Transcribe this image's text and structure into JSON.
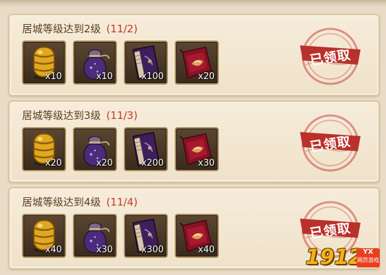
{
  "colors": {
    "progress": "#c0392b",
    "stamp": "#b8312a",
    "panel_bg": "#f3e8d4"
  },
  "tasks": [
    {
      "title": "居城等级达到2级",
      "progress": "(11/2)",
      "items": [
        {
          "icon": "gold-ingot-icon",
          "qty": "x10"
        },
        {
          "icon": "potion-bag-icon",
          "qty": "x10"
        },
        {
          "icon": "scroll-book-icon",
          "qty": "x100"
        },
        {
          "icon": "red-talisman-icon",
          "qty": "x20"
        }
      ],
      "stamp": "已领取"
    },
    {
      "title": "居城等级达到3级",
      "progress": "(11/3)",
      "items": [
        {
          "icon": "gold-ingot-icon",
          "qty": "x20"
        },
        {
          "icon": "potion-bag-icon",
          "qty": "x20"
        },
        {
          "icon": "scroll-book-icon",
          "qty": "x200"
        },
        {
          "icon": "red-talisman-icon",
          "qty": "x30"
        }
      ],
      "stamp": "已领取"
    },
    {
      "title": "居城等级达到4级",
      "progress": "(11/4)",
      "items": [
        {
          "icon": "gold-ingot-icon",
          "qty": "x40"
        },
        {
          "icon": "potion-bag-icon",
          "qty": "x30"
        },
        {
          "icon": "scroll-book-icon",
          "qty": "x300"
        },
        {
          "icon": "red-talisman-icon",
          "qty": "x40"
        }
      ],
      "stamp": "已领取"
    }
  ],
  "watermark": {
    "number": "1912",
    "badge_top": "YX",
    "badge_bottom": "网页游戏"
  }
}
